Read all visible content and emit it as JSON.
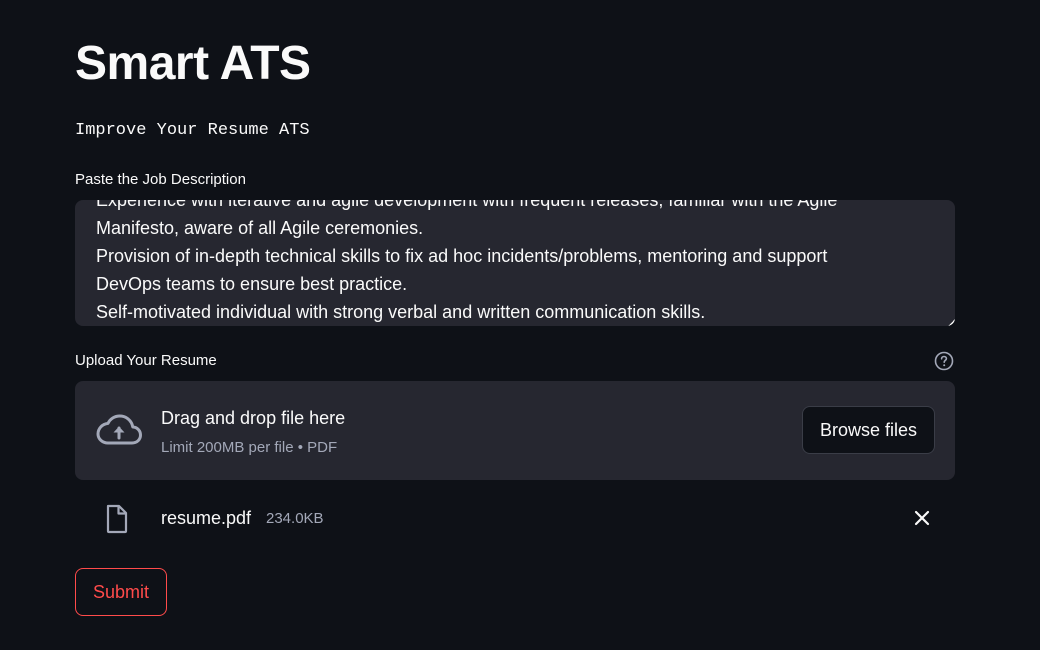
{
  "page": {
    "title": "Smart ATS",
    "subtitle": "Improve Your Resume ATS"
  },
  "job_description": {
    "label": "Paste the Job Description",
    "lines": [
      "Experience with iterative and agile development with frequent releases, familiar with the Agile",
      "Manifesto, aware of all Agile ceremonies.",
      "Provision of in-depth technical skills to fix ad hoc incidents/problems, mentoring and support",
      "DevOps teams to ensure best practice.",
      "Self-motivated individual with strong verbal and written communication skills."
    ]
  },
  "uploader": {
    "label": "Upload Your Resume",
    "help_icon": "question-circle-icon",
    "drop_title": "Drag and drop file here",
    "drop_limit": "Limit 200MB per file • PDF",
    "browse_label": "Browse files",
    "upload_icon": "cloud-upload-icon"
  },
  "uploaded_file": {
    "name": "resume.pdf",
    "size": "234.0KB",
    "icon": "file-icon",
    "remove_icon": "close-icon"
  },
  "actions": {
    "submit_label": "Submit"
  },
  "colors": {
    "background": "#0e1117",
    "surface": "#262730",
    "accent": "#ff4b4b",
    "muted_text": "#a3a8b8"
  }
}
